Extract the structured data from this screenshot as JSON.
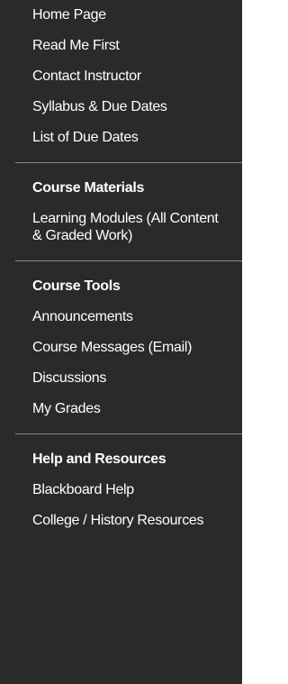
{
  "sections": [
    {
      "header": "",
      "items": [
        "Home Page",
        "Read Me First",
        "Contact Instructor",
        "Syllabus & Due Dates",
        "List of Due Dates"
      ]
    },
    {
      "header": "Course Materials",
      "items": [
        "Learning Modules (All Content & Graded Work)"
      ]
    },
    {
      "header": "Course Tools",
      "items": [
        "Announcements",
        "Course Messages (Email)",
        "Discussions",
        "My Grades"
      ]
    },
    {
      "header": "Help and Resources",
      "items": [
        "Blackboard Help",
        "College / History Resources"
      ]
    }
  ]
}
